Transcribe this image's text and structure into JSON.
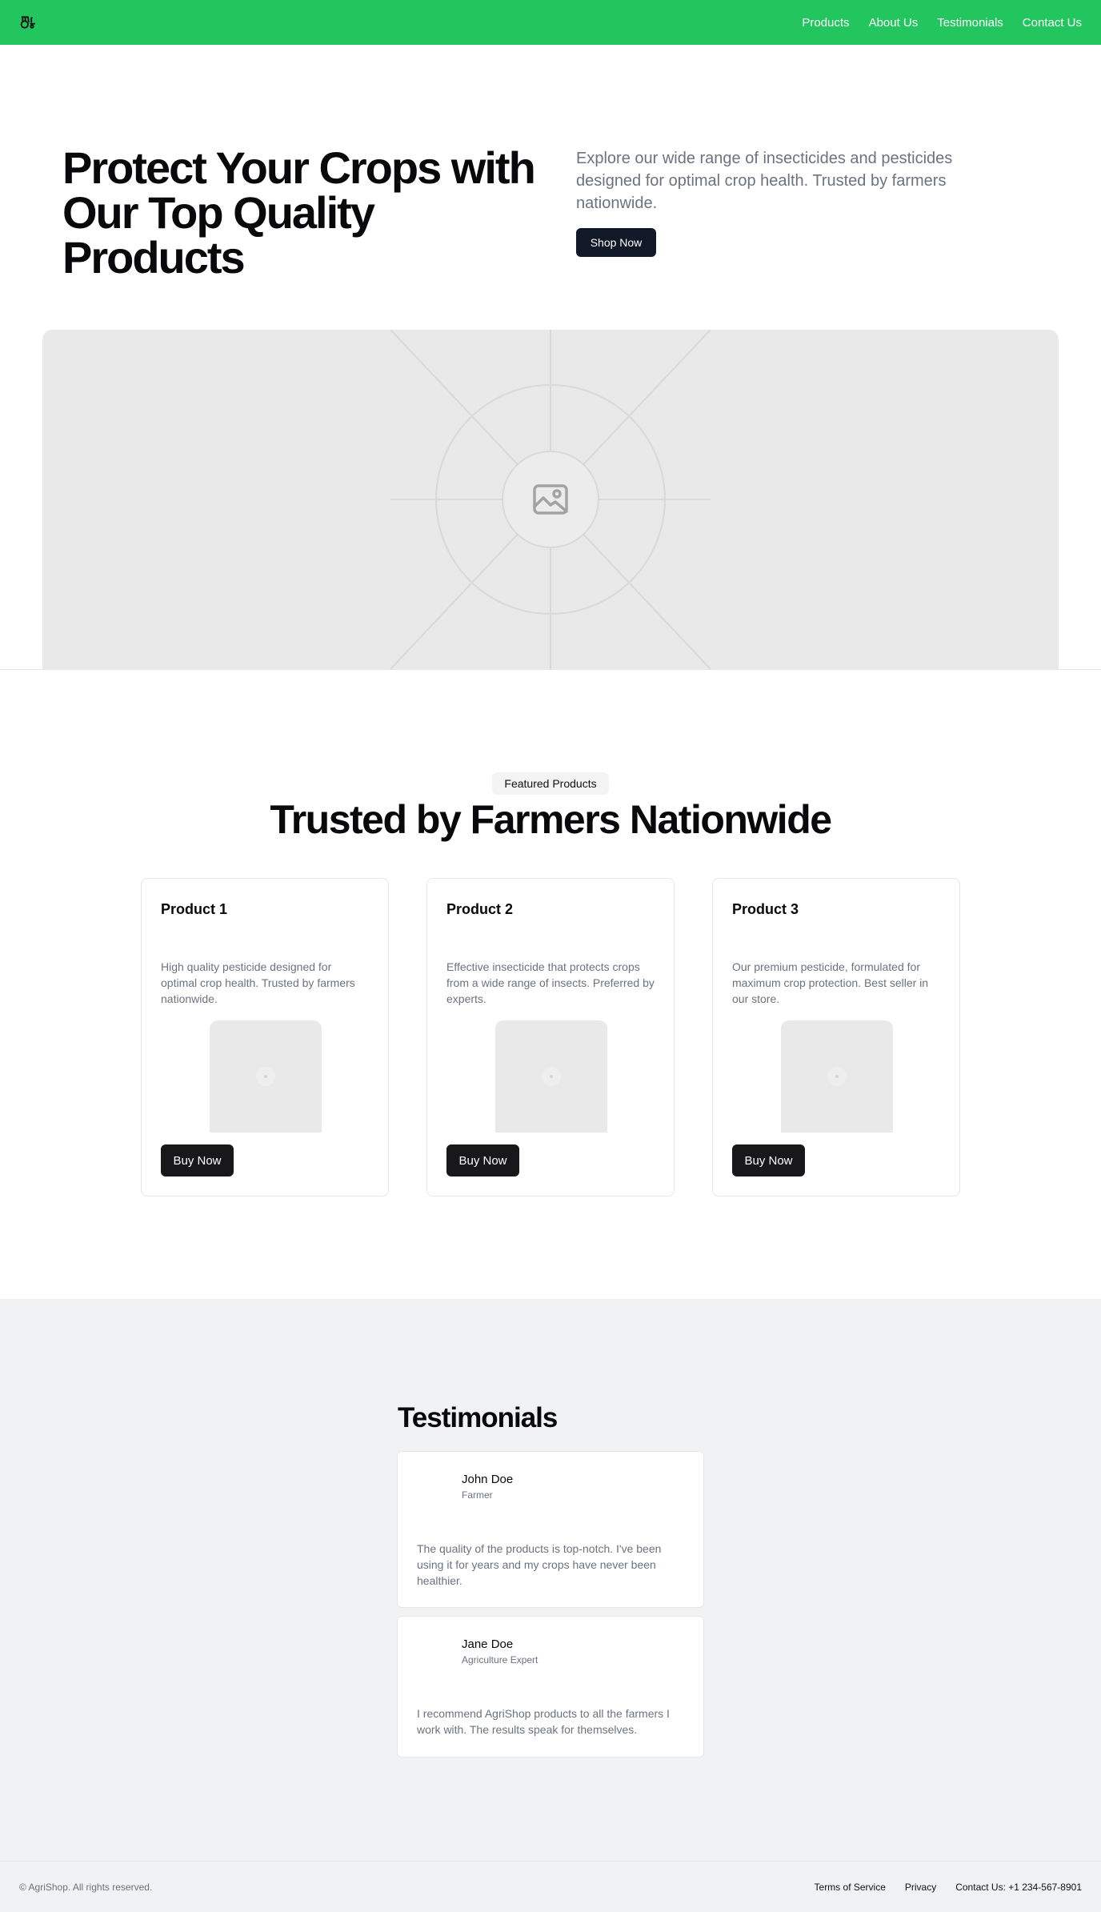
{
  "header": {
    "logo_icon": "tractor-icon",
    "nav": [
      "Products",
      "About Us",
      "Testimonials",
      "Contact Us"
    ]
  },
  "hero": {
    "title": "Protect Your Crops with Our Top Quality Products",
    "description": "Explore our wide range of insecticides and pesticides designed for optimal crop health. Trusted by farmers nationwide.",
    "cta": "Shop Now",
    "image_icon": "image-placeholder-icon"
  },
  "featured": {
    "badge": "Featured Products",
    "title": "Trusted by Farmers Nationwide",
    "products": [
      {
        "title": "Product 1",
        "description": "High quality pesticide designed for optimal crop health. Trusted by farmers nationwide.",
        "button": "Buy Now"
      },
      {
        "title": "Product 2",
        "description": "Effective insecticide that protects crops from a wide range of insects. Preferred by experts.",
        "button": "Buy Now"
      },
      {
        "title": "Product 3",
        "description": "Our premium pesticide, formulated for maximum crop protection. Best seller in our store.",
        "button": "Buy Now"
      }
    ]
  },
  "testimonials": {
    "title": "Testimonials",
    "items": [
      {
        "name": "John Doe",
        "role": "Farmer",
        "quote": "The quality of the products is top-notch. I've been using it for years and my crops have never been healthier."
      },
      {
        "name": "Jane Doe",
        "role": "Agriculture Expert",
        "quote": "I recommend AgriShop products to all the farmers I work with. The results speak for themselves."
      }
    ]
  },
  "footer": {
    "copyright": "© AgriShop. All rights reserved.",
    "links": [
      "Terms of Service",
      "Privacy",
      "Contact Us: +1 234-567-8901"
    ]
  },
  "colors": {
    "header_bg": "#22c55e",
    "primary_button": "#111827",
    "muted_text": "#6b7280",
    "section_bg": "#f1f2f4"
  }
}
